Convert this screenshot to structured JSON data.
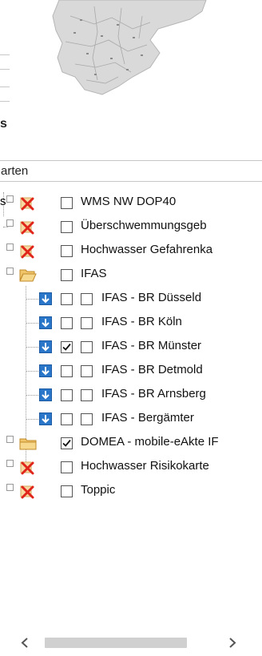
{
  "section_heading": "s",
  "layer_combo": {
    "value": "arten"
  },
  "tree": {
    "items": [
      {
        "label": "WMS NW DOP40",
        "checked": false,
        "icon": "broken-layer-icon"
      },
      {
        "label": "Überschwemmungsgeb",
        "checked": false,
        "icon": "broken-layer-icon"
      },
      {
        "label": "Hochwasser Gefahrenka",
        "checked": false,
        "icon": "broken-layer-icon"
      },
      {
        "label": "IFAS",
        "checked": false,
        "icon": "folder-open-icon",
        "children": [
          {
            "label": "IFAS - BR Düsseld",
            "checked": false
          },
          {
            "label": "IFAS - BR Köln",
            "checked": false
          },
          {
            "label": "IFAS - BR Münster",
            "checked": true
          },
          {
            "label": "IFAS - BR Detmold",
            "checked": false
          },
          {
            "label": "IFAS - BR Arnsberg",
            "checked": false
          },
          {
            "label": "IFAS - Bergämter",
            "checked": false
          }
        ]
      },
      {
        "label": "DOMEA - mobile-eAkte IF",
        "checked": true,
        "icon": "folder-closed-icon"
      },
      {
        "label": "Hochwasser Risikokarte",
        "checked": false,
        "icon": "broken-layer-icon"
      },
      {
        "label": "Toppic",
        "checked": false,
        "icon": "broken-layer-icon"
      }
    ]
  },
  "scrollbar": {
    "left_arrow": "‹",
    "right_arrow": "›"
  },
  "colors": {
    "accent": "#2a76c9",
    "error": "#e0261b",
    "folder": "#e9b44c"
  }
}
